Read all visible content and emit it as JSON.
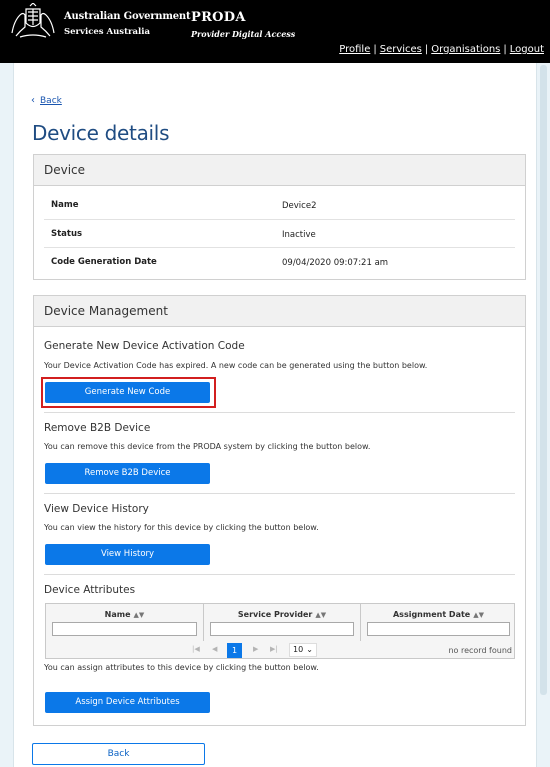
{
  "header": {
    "gov_line1": "Australian Government",
    "gov_line2": "Services Australia",
    "app_name": "PRODA",
    "app_subtitle": "Provider Digital Access",
    "nav": [
      "Profile",
      "Services",
      "Organisations",
      "Logout"
    ]
  },
  "back_link": "Back",
  "page_title": "Device details",
  "device_panel": {
    "title": "Device",
    "rows": [
      {
        "label": "Name",
        "value": "Device2"
      },
      {
        "label": "Status",
        "value": "Inactive"
      },
      {
        "label": "Code Generation Date",
        "value": "09/04/2020 09:07:21 am"
      }
    ]
  },
  "management_panel": {
    "title": "Device Management",
    "generate": {
      "title": "Generate New Device Activation Code",
      "desc": "Your Device Activation Code has expired. A new code can be generated using the button below.",
      "button": "Generate New Code"
    },
    "remove": {
      "title": "Remove B2B Device",
      "desc": "You can remove this device from the PRODA system by clicking the button below.",
      "button": "Remove B2B Device"
    },
    "history": {
      "title": "View Device History",
      "desc": "You can view the history for this device by clicking the button below.",
      "button": "View History"
    },
    "attributes": {
      "title": "Device Attributes",
      "columns": [
        "Name",
        "Service Provider",
        "Assignment Date"
      ],
      "current_page": "1",
      "page_size": "10",
      "empty_text": "no record found",
      "desc": "You can assign attributes to this device by clicking the button below.",
      "button": "Assign Device Attributes"
    }
  },
  "footer_back_button": "Back",
  "colors": {
    "header_bg": "#000000",
    "title_blue": "#1f4c82",
    "button_blue": "#0b78e8",
    "highlight_red": "#d21f1f"
  }
}
